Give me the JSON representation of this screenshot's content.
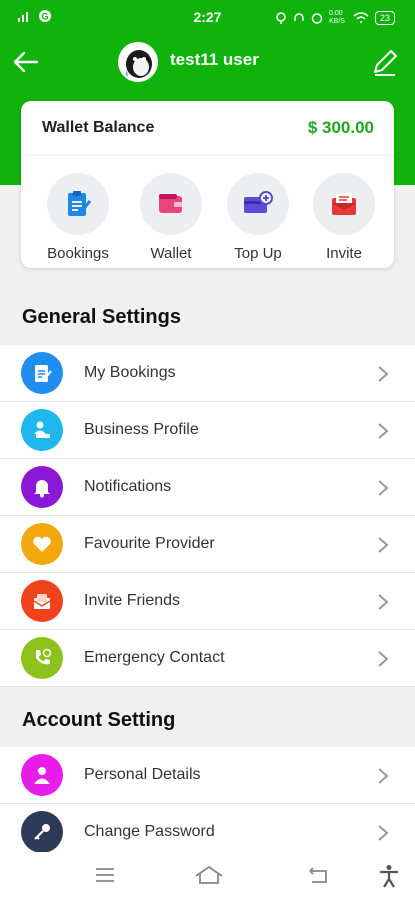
{
  "status_bar": {
    "time": "2:27",
    "left_text": "•ıl",
    "right_text": "0.00 KB/S",
    "battery": "23"
  },
  "header": {
    "user_name": "test11 user"
  },
  "wallet": {
    "title": "Wallet Balance",
    "amount": "$ 300.00",
    "actions": [
      {
        "label": "Bookings",
        "icon": "clipboard-icon"
      },
      {
        "label": "Wallet",
        "icon": "wallet-icon"
      },
      {
        "label": "Top Up",
        "icon": "topup-card-icon"
      },
      {
        "label": "Invite",
        "icon": "envelope-icon"
      }
    ]
  },
  "general": {
    "title": "General Settings",
    "items": [
      {
        "label": "My Bookings",
        "icon": "clipboard-icon",
        "color": "#1f8ef0"
      },
      {
        "label": "Business Profile",
        "icon": "business-icon",
        "color": "#1fb7ee"
      },
      {
        "label": "Notifications",
        "icon": "bell-icon",
        "color": "#8b18d6"
      },
      {
        "label": "Favourite Provider",
        "icon": "heart-icon",
        "color": "#f2a70c"
      },
      {
        "label": "Invite Friends",
        "icon": "envelope-icon",
        "color": "#f0421c"
      },
      {
        "label": "Emergency Contact",
        "icon": "phone-icon",
        "color": "#8cc21b"
      }
    ]
  },
  "account": {
    "title": "Account Setting",
    "items": [
      {
        "label": "Personal Details",
        "icon": "person-icon",
        "color": "#e61ee8"
      },
      {
        "label": "Change Password",
        "icon": "key-icon",
        "color": "#2c3a57"
      }
    ]
  },
  "colors": {
    "brand_green": "#10b30b",
    "amount_green": "#1fa81a"
  }
}
